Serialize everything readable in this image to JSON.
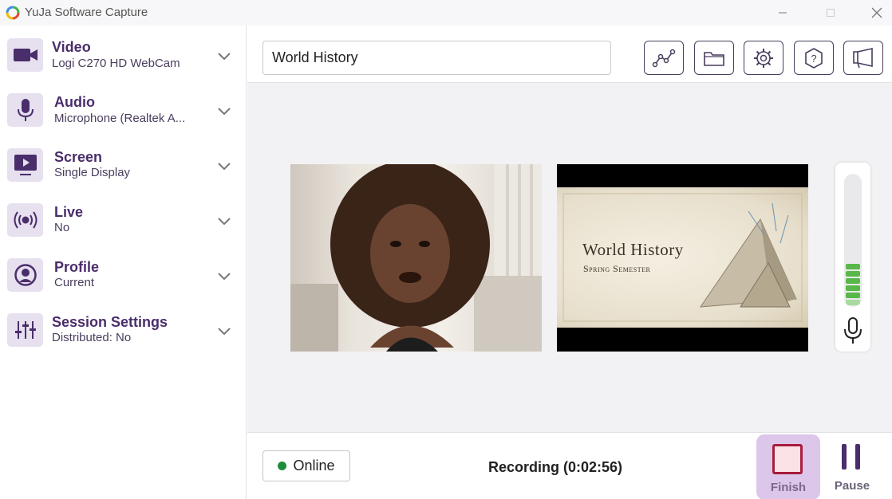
{
  "window": {
    "title": "YuJa Software Capture"
  },
  "sidebar": {
    "items": [
      {
        "title": "Video",
        "subtitle": "Logi C270 HD WebCam",
        "icon": "video-camera-icon"
      },
      {
        "title": "Audio",
        "subtitle": "Microphone (Realtek A...",
        "icon": "microphone-icon"
      },
      {
        "title": "Screen",
        "subtitle": "Single Display",
        "icon": "screen-icon"
      },
      {
        "title": "Live",
        "subtitle": "No",
        "icon": "broadcast-icon"
      },
      {
        "title": "Profile",
        "subtitle": "Current",
        "icon": "profile-icon"
      },
      {
        "title": "Session Settings",
        "subtitle": "Distributed: No",
        "icon": "sliders-icon"
      }
    ]
  },
  "toolbar": {
    "title_value": "World History",
    "buttons": [
      "analytics-icon",
      "folder-icon",
      "settings-gear-icon",
      "help-icon",
      "announcement-icon"
    ]
  },
  "preview": {
    "slide_title": "World History",
    "slide_subtitle": "Spring Semester"
  },
  "audio_meter": {
    "level_bars_active": 6
  },
  "bottom": {
    "status": "Online",
    "recording": "Recording (0:02:56)",
    "finish_label": "Finish",
    "pause_label": "Pause"
  },
  "colors": {
    "accent": "#4a2d6b",
    "icon_bg": "#e6e0ef",
    "online": "#1e8c3a",
    "finish_highlight": "#dcc6e9",
    "finish_stop": "#a81c3c",
    "meter_green": "#58b849"
  }
}
